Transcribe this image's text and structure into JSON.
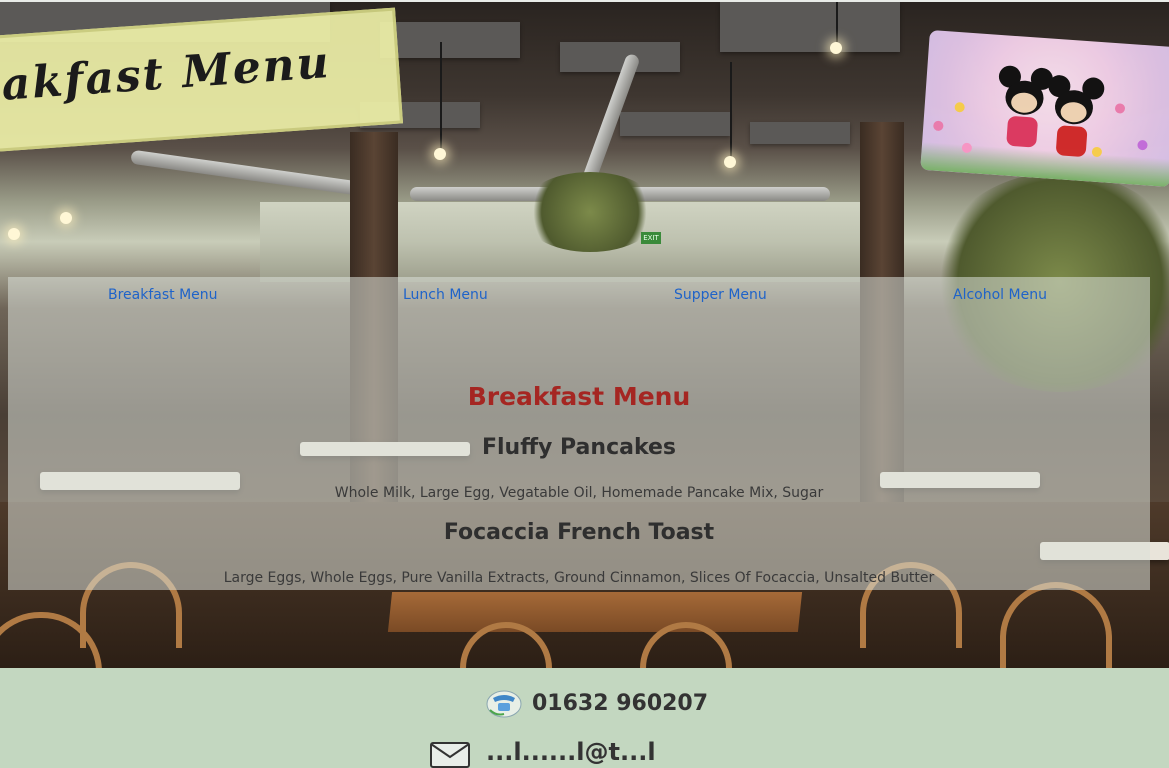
{
  "banner": {
    "title": "eakfast Menu"
  },
  "nav": {
    "items": [
      {
        "label": "Breakfast Menu"
      },
      {
        "label": "Lunch Menu"
      },
      {
        "label": "Supper Menu"
      },
      {
        "label": "Alcohol Menu"
      }
    ]
  },
  "menu": {
    "section_title": "Breakfast Menu",
    "items": [
      {
        "name": "Fluffy Pancakes",
        "description": "Whole Milk, Large Egg, Vegatable Oil, Homemade Pancake Mix, Sugar"
      },
      {
        "name": "Focaccia French Toast",
        "description": "Large Eggs, Whole Eggs, Pure Vanilla Extracts, Ground Cinnamon, Slices Of Focaccia, Unsalted Butter"
      }
    ]
  },
  "hero": {
    "exit_sign": "EXIT"
  },
  "footer": {
    "phone": "01632 960207",
    "email": "...l......l@t...l"
  },
  "colors": {
    "nav_link": "#1f63c9",
    "section_title": "#a52622",
    "footer_bg": "#c3d7c0"
  },
  "icons": {
    "phone": "phone-icon",
    "mail": "mail-icon"
  }
}
